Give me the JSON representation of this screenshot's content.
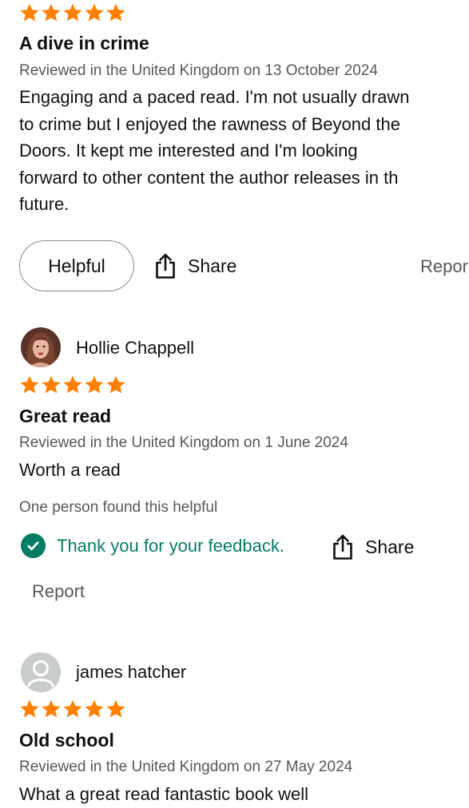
{
  "colors": {
    "star": "#ff8000",
    "success": "#067d62",
    "meta_text": "#565959"
  },
  "reviews": [
    {
      "rating": 5,
      "title": "A dive in crime",
      "meta": "Reviewed in the United Kingdom on 13 October 2024",
      "body_lines": [
        "Engaging and a paced read. I'm not usually drawn",
        "to crime but I enjoyed the rawness of Beyond the",
        "Doors. It kept me interested and I'm looking",
        "forward to other content the author releases in th",
        "future."
      ],
      "helpful_label": "Helpful",
      "share_label": "Share",
      "report_label": "Repor"
    },
    {
      "reviewer": "Hollie Chappell",
      "rating": 5,
      "title": "Great read",
      "meta": "Reviewed in the United Kingdom on 1 June 2024",
      "body": "Worth a read",
      "helpful_count": "One person found this helpful",
      "feedback": "Thank you for your feedback.",
      "share_label": "Share",
      "report_label": "Report"
    },
    {
      "reviewer": "james hatcher",
      "rating": 5,
      "title": "Old school",
      "meta": "Reviewed in the United Kingdom on 27 May 2024",
      "body": "What a great read fantastic book well"
    }
  ]
}
